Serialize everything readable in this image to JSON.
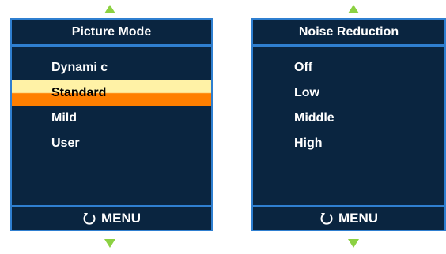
{
  "left_panel": {
    "title": "Picture Mode",
    "items": [
      {
        "label": "Dynami c",
        "selected": false
      },
      {
        "label": "Standard",
        "selected": true
      },
      {
        "label": "Mild",
        "selected": false
      },
      {
        "label": "User",
        "selected": false
      }
    ],
    "footer_label": "MENU",
    "footer_icon": "back-arrow-icon"
  },
  "right_panel": {
    "title": "Noise Reduction",
    "items": [
      {
        "label": "Off",
        "selected": false
      },
      {
        "label": "Low",
        "selected": false
      },
      {
        "label": "Middle",
        "selected": false
      },
      {
        "label": "High",
        "selected": false
      }
    ],
    "footer_label": "MENU",
    "footer_icon": "back-arrow-icon"
  },
  "colors": {
    "panel_bg": "#0a2540",
    "panel_border": "#2f7fd0",
    "arrow": "#8cd142",
    "selected_top": "#fff2a6",
    "selected_bottom": "#ff7f00"
  }
}
